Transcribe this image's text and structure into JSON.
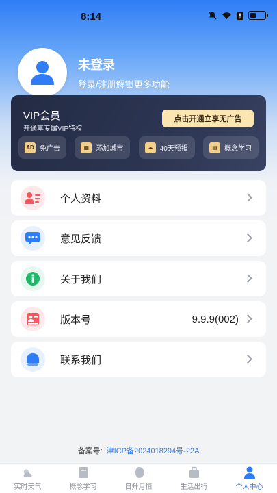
{
  "status": {
    "time": "8:14",
    "battery": "▮"
  },
  "profile": {
    "name": "未登录",
    "subtitle": "登录/注册解锁更多功能"
  },
  "vip": {
    "title": "VIP会员",
    "subtitle": "开通享专属VIP特权",
    "cta": "点击开通立享无广告",
    "features": [
      {
        "label": "免广告",
        "icon": "ad-icon",
        "glyph": "AD"
      },
      {
        "label": "添加城市",
        "icon": "city-icon",
        "glyph": "▦"
      },
      {
        "label": "40天预报",
        "icon": "weather-icon",
        "glyph": "☁"
      },
      {
        "label": "概念学习",
        "icon": "book-icon",
        "glyph": "▤"
      }
    ]
  },
  "menu": [
    {
      "label": "个人资料",
      "icon": "profile-card-icon",
      "value": ""
    },
    {
      "label": "意见反馈",
      "icon": "chat-bubble-icon",
      "value": ""
    },
    {
      "label": "关于我们",
      "icon": "info-icon",
      "value": ""
    },
    {
      "label": "版本号",
      "icon": "version-icon",
      "value": "9.9.9(002)"
    },
    {
      "label": "联系我们",
      "icon": "service-icon",
      "value": ""
    }
  ],
  "icp": {
    "label": "备案号:",
    "number": "津ICP备2024018294号-22A"
  },
  "tabs": [
    {
      "label": "实时天气",
      "icon": "weather-tab-icon",
      "active": false
    },
    {
      "label": "概念学习",
      "icon": "book-tab-icon",
      "active": false
    },
    {
      "label": "日升月恒",
      "icon": "moon-tab-icon",
      "active": false
    },
    {
      "label": "生活出行",
      "icon": "bag-tab-icon",
      "active": false
    },
    {
      "label": "个人中心",
      "icon": "user-tab-icon",
      "active": true
    }
  ],
  "colors": {
    "accent": "#2f7df6",
    "vip_bg": "#232b44",
    "vip_cta": "#fbe6b2"
  }
}
